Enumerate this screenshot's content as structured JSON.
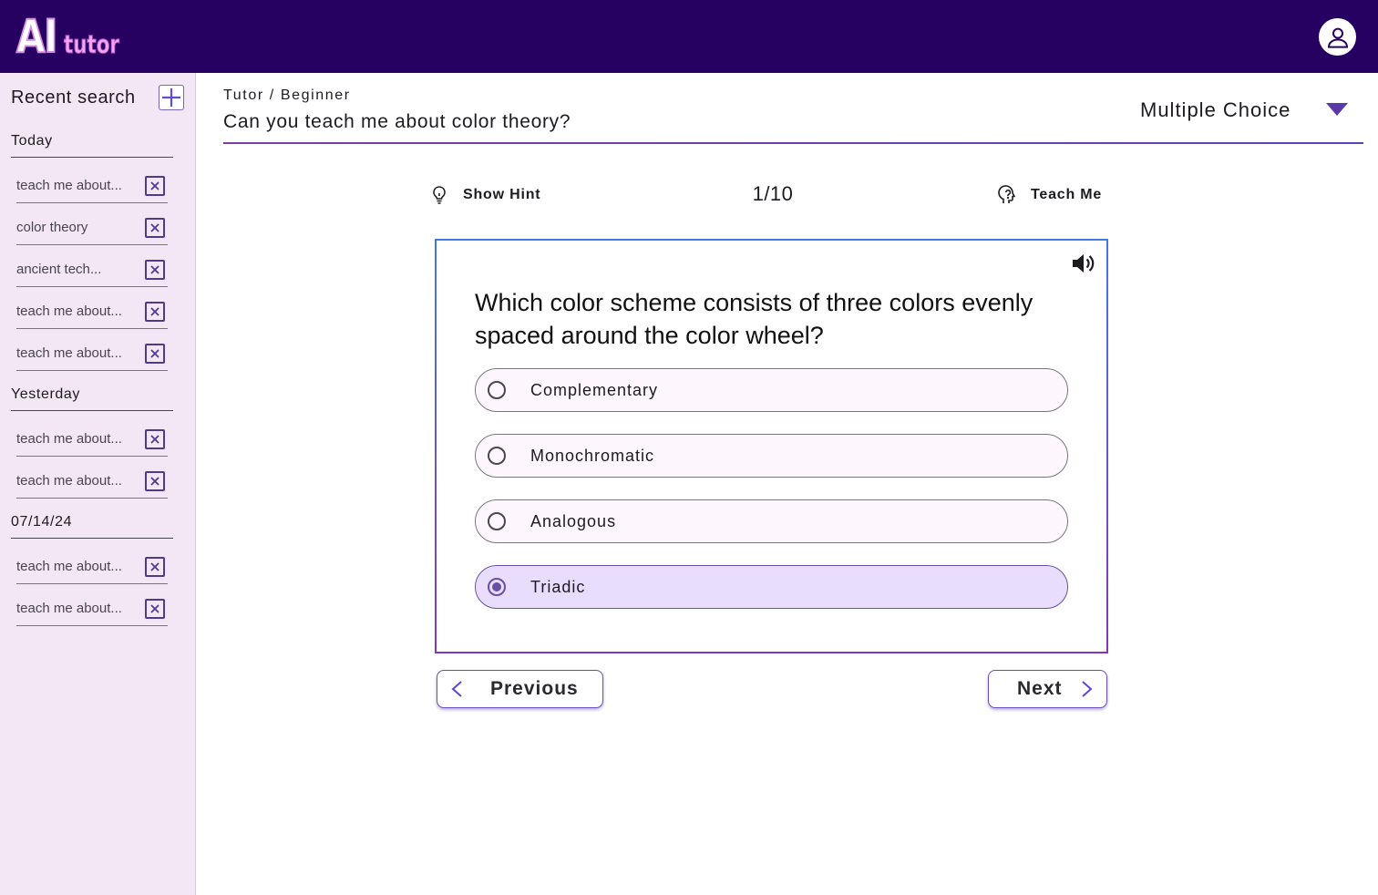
{
  "header": {
    "logo_ai": "AI",
    "logo_tutor": "tutor"
  },
  "sidebar": {
    "title": "Recent search",
    "groups": [
      {
        "label": "Today",
        "items": [
          {
            "label": "teach me about..."
          },
          {
            "label": "color theory"
          },
          {
            "label": "ancient tech..."
          },
          {
            "label": "teach me about..."
          },
          {
            "label": "teach me about..."
          }
        ]
      },
      {
        "label": "Yesterday",
        "items": [
          {
            "label": "teach me about..."
          },
          {
            "label": "teach me about..."
          }
        ]
      },
      {
        "label": "07/14/24",
        "items": [
          {
            "label": "teach me about..."
          },
          {
            "label": "teach me about..."
          }
        ]
      }
    ]
  },
  "main": {
    "breadcrumb": "Tutor / Beginner",
    "title": "Can you teach me about color theory?",
    "mode": "Multiple Choice",
    "show_hint": "Show Hint",
    "counter": "1/10",
    "teach_me": "Teach Me",
    "question": "Which color scheme consists of three colors evenly spaced around the color wheel?",
    "options": [
      {
        "label": "Complementary",
        "selected": false
      },
      {
        "label": "Monochromatic",
        "selected": false
      },
      {
        "label": "Analogous",
        "selected": false
      },
      {
        "label": "Triadic",
        "selected": true
      }
    ],
    "previous": "Previous",
    "next": "Next"
  },
  "colors": {
    "header_bg": "#260161",
    "sidebar_bg": "#f3e7f5",
    "accent": "#6750a4",
    "selected_option_bg": "#e9ddfd"
  }
}
